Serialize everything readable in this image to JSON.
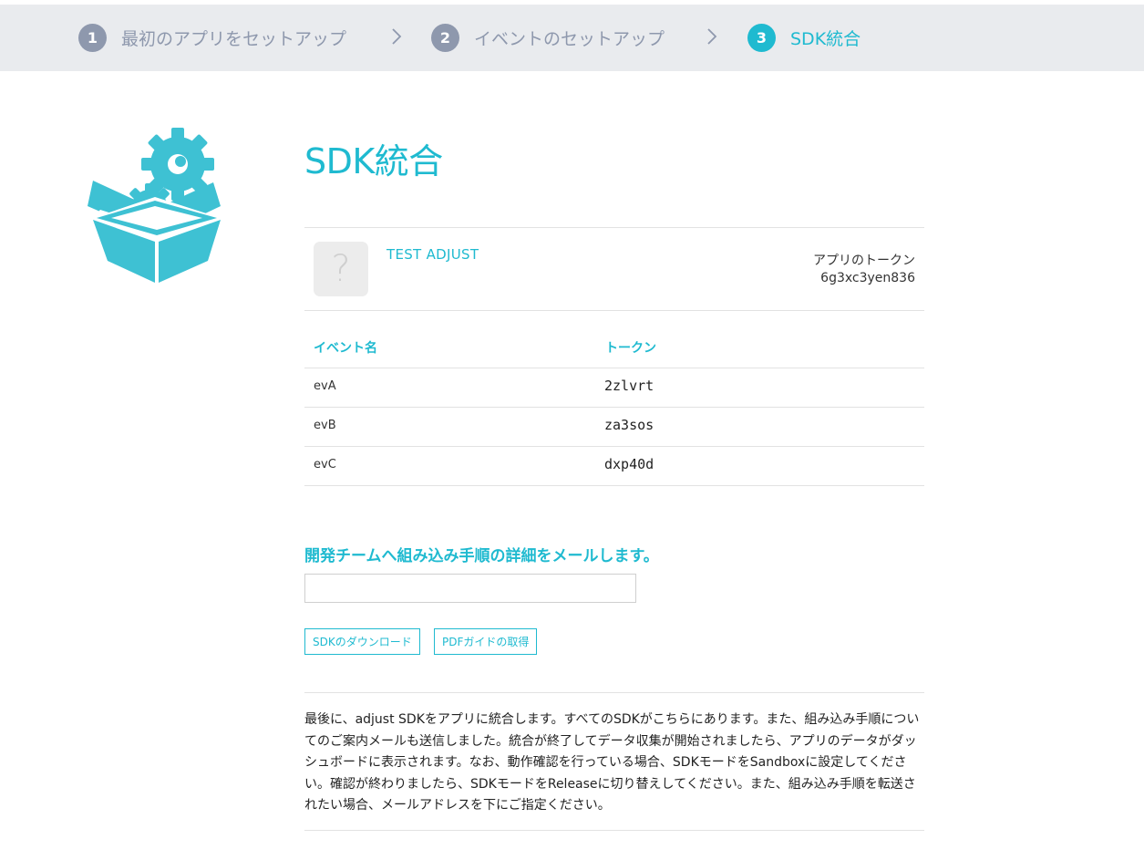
{
  "steps": [
    {
      "number": "1",
      "label": "最初のアプリをセットアップ"
    },
    {
      "number": "2",
      "label": "イベントのセットアップ"
    },
    {
      "number": "3",
      "label": "SDK統合"
    }
  ],
  "page_title": "SDK統合",
  "app": {
    "placeholder_glyph": "?",
    "name": "TEST ADJUST",
    "token_label": "アプリのトークン",
    "token_value": "6g3xc3yen836"
  },
  "events_table": {
    "headers": {
      "name": "イベント名",
      "token": "トークン"
    },
    "rows": [
      {
        "name": "evA",
        "token": "2zlvrt"
      },
      {
        "name": "evB",
        "token": "za3sos"
      },
      {
        "name": "evC",
        "token": "dxp40d"
      }
    ]
  },
  "mail": {
    "heading": "開発チームへ組み込み手順の詳細をメールします。",
    "value": "",
    "placeholder": ""
  },
  "buttons": {
    "download_sdk": "SDKのダウンロード",
    "pdf_guide": "PDFガイドの取得"
  },
  "description": "最後に、adjust SDKをアプリに統合します。すべてのSDKがこちらにあります。また、組み込み手順についてのご案内メールも送信しました。統合が終了してデータ収集が開始されましたら、アプリのデータがダッシュボードに表示されます。なお、動作確認を行っている場合、SDKモードをSandboxに設定してください。確認が終わりましたら、SDKモードをReleaseに切り替えしてください。また、組み込み手順を転送されたい場合、メールアドレスを下にご指定ください。",
  "icons": {
    "hero": "box-with-gears-icon",
    "step_separator": "chevron-right-icon"
  },
  "colors": {
    "accent": "#1fbad0",
    "step_inactive": "#8e98ad",
    "step_bar_bg": "#e9ebee"
  }
}
